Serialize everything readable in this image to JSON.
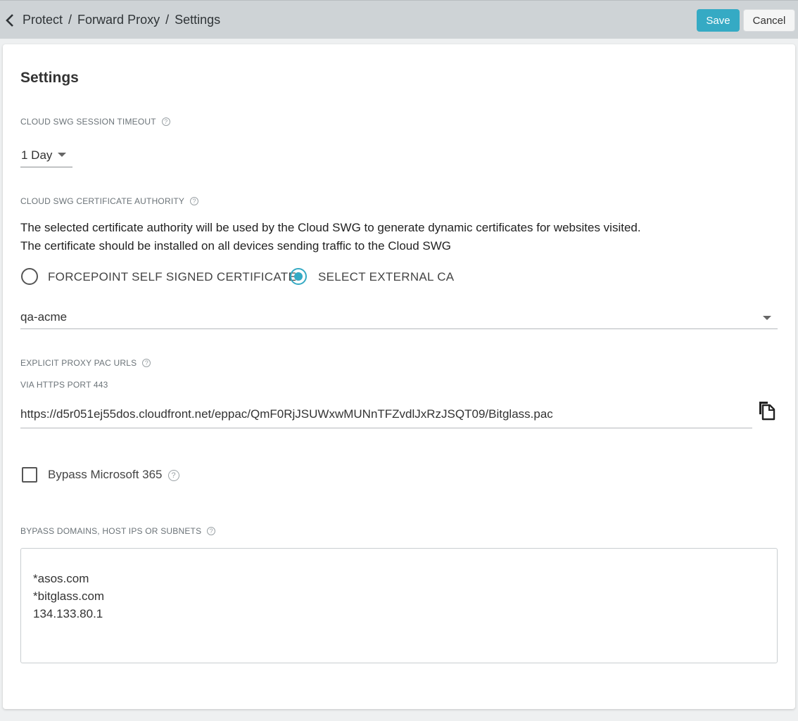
{
  "breadcrumb": {
    "items": [
      "Protect",
      "Forward Proxy",
      "Settings"
    ],
    "separator": "/"
  },
  "toolbar": {
    "save_label": "Save",
    "cancel_label": "Cancel"
  },
  "colors": {
    "accent": "#35aac4",
    "topbar": "#ced3d6"
  },
  "settings": {
    "title": "Settings",
    "session_timeout": {
      "label": "CLOUD SWG SESSION TIMEOUT",
      "value": "1 Day"
    },
    "certificate_authority": {
      "label": "CLOUD SWG CERTIFICATE AUTHORITY",
      "description_line1": "The selected certificate authority will be used by the Cloud SWG to generate dynamic certificates for websites visited.",
      "description_line2": "The certificate should be installed on all devices sending traffic to the Cloud SWG",
      "options": [
        {
          "label": "FORCEPOINT SELF SIGNED CERTIFICATE",
          "selected": false
        },
        {
          "label": "SELECT EXTERNAL CA",
          "selected": true
        }
      ],
      "selected_ca": "qa-acme"
    },
    "pac_urls": {
      "label": "EXPLICIT PROXY PAC URLS",
      "sublabel": "VIA HTTPS PORT 443",
      "url": "https://d5r051ej55dos.cloudfront.net/eppac/QmF0RjJSUWxwMUNnTFZvdlJxRzJSQT09/Bitglass.pac"
    },
    "bypass_m365": {
      "label": "Bypass Microsoft 365",
      "checked": false
    },
    "bypass_domains": {
      "label": "BYPASS DOMAINS, HOST IPS OR SUBNETS",
      "lines": [
        "*asos.com",
        "*bitglass.com",
        "134.133.80.1"
      ]
    }
  },
  "icons": {
    "back": "chevron-left-icon",
    "help": "help-circle-icon",
    "dropdown": "caret-down-icon",
    "copy": "copy-icon"
  }
}
